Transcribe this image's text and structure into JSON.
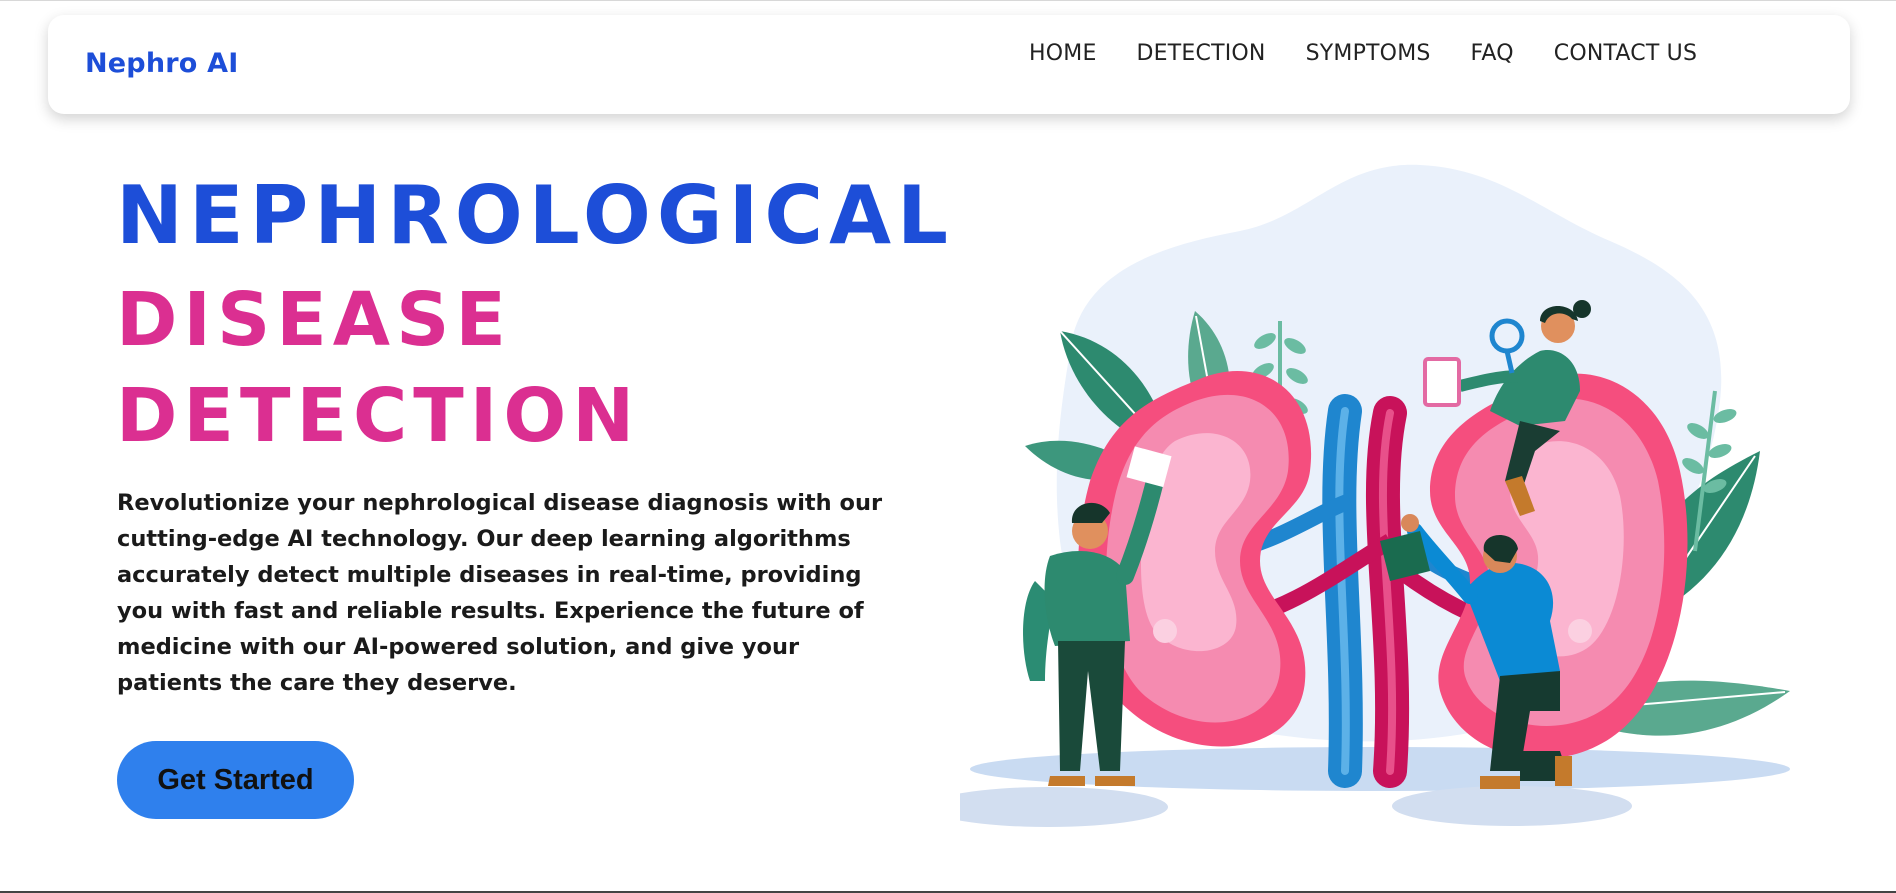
{
  "brand": {
    "name": "Nephro AI"
  },
  "nav": {
    "items": [
      {
        "label": "HOME"
      },
      {
        "label": "DETECTION"
      },
      {
        "label": "SYMPTOMS"
      },
      {
        "label": "FAQ"
      },
      {
        "label": "CONTACT US"
      }
    ]
  },
  "hero": {
    "title_line1": "NEPHROLOGICAL",
    "title_line2": "DISEASE",
    "title_line3": "DETECTION",
    "description_lines": [
      "Revolutionize your nephrological disease diagnosis with our",
      "cutting-edge AI technology. Our deep learning algorithms",
      "accurately detect multiple diseases in real-time, providing",
      "you with fast and reliable results. Experience the future of",
      "medicine with our AI-powered solution, and give your",
      "patients the care they deserve."
    ],
    "cta_label": "Get Started"
  },
  "colors": {
    "brand_blue": "#1d4ed8",
    "accent_pink": "#db2f91",
    "button_blue": "#2f80ed"
  },
  "illustration": {
    "icon": "kidney-illustration"
  }
}
